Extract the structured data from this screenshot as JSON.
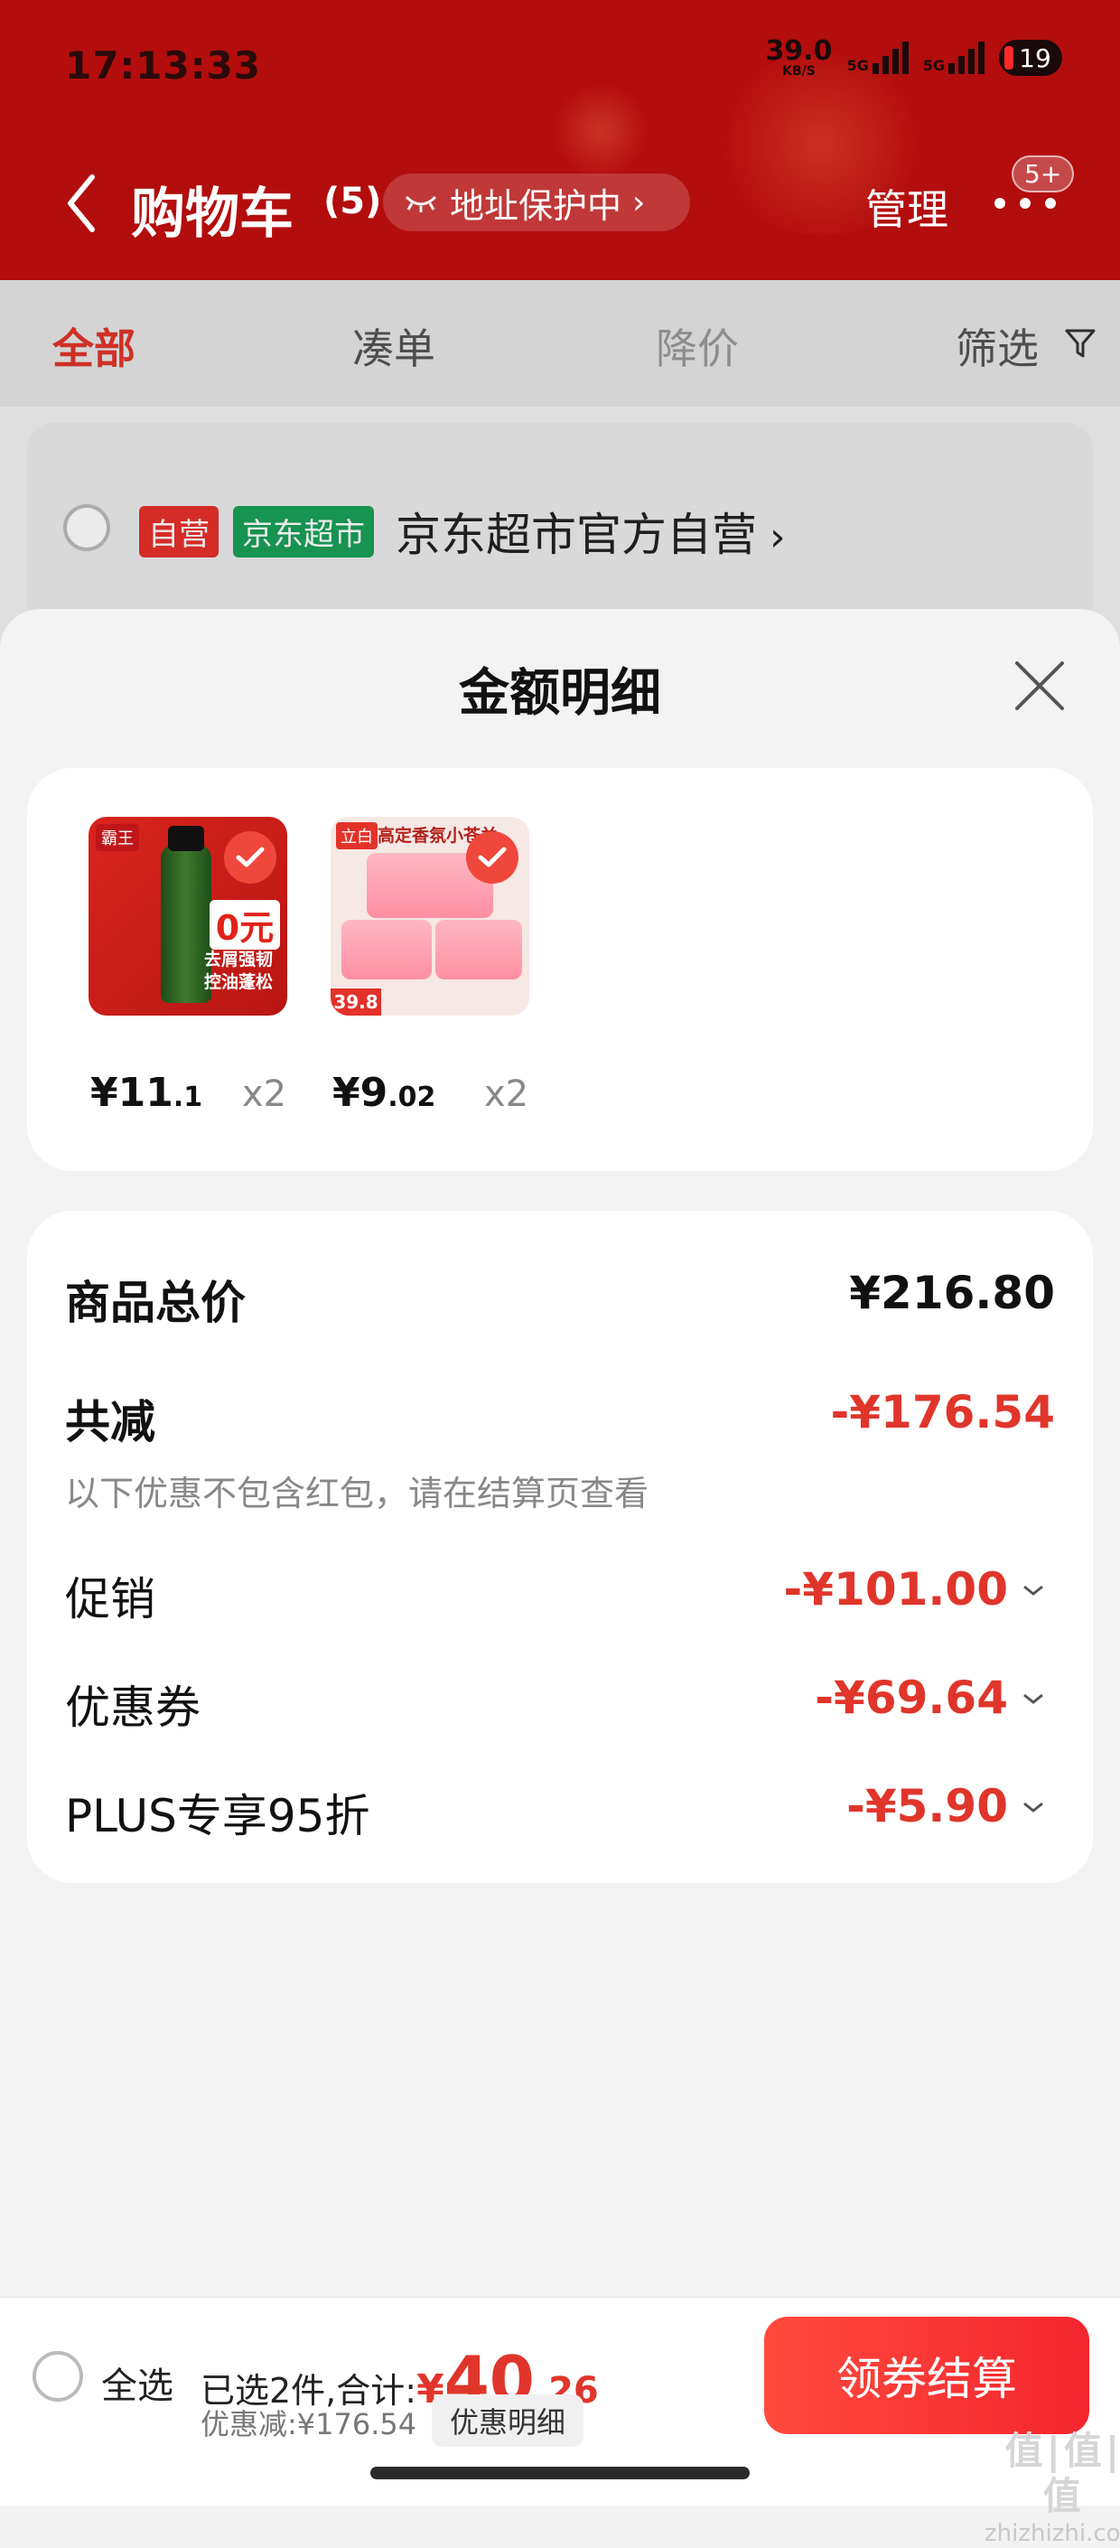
{
  "status_bar": {
    "time": "17:13:33",
    "net_speed_value": "39.0",
    "net_speed_unit": "KB/S",
    "signal1_label": "5G",
    "signal2_label": "5G",
    "battery": "19"
  },
  "header": {
    "title": "购物车",
    "count": "(5)",
    "address_protection": "地址保护中",
    "manage": "管理",
    "more_badge": "5+"
  },
  "tabs": [
    {
      "label": "全部",
      "active": true
    },
    {
      "label": "凑单",
      "active": false
    },
    {
      "label": "降价",
      "active": false
    },
    {
      "label": "筛选",
      "active": false
    }
  ],
  "store": {
    "tag_self": "自营",
    "tag_market": "京东超市",
    "name": "京东超市官方自营"
  },
  "sheet": {
    "title": "金额明细",
    "products": [
      {
        "price_int": "¥11",
        "price_dec": ".1",
        "qty": "x2",
        "thumb_texts": [
          "霸王",
          "0元",
          "去屑强韧",
          "控油蓬松"
        ]
      },
      {
        "price_int": "¥9",
        "price_dec": ".02",
        "qty": "x2",
        "thumb_texts": [
          "立白",
          "高定香氛小苍兰",
          "39.8"
        ]
      }
    ],
    "summary": {
      "total_label": "商品总价",
      "total_value": "¥216.80",
      "reduce_label": "共减",
      "reduce_value": "-¥176.54",
      "note": "以下优惠不包含红包，请在结算页查看",
      "items": [
        {
          "label": "促销",
          "value": "-¥101.00"
        },
        {
          "label": "优惠券",
          "value": "-¥69.64"
        },
        {
          "label": "PLUS专享95折",
          "value": "-¥5.90"
        }
      ]
    }
  },
  "bottom": {
    "select_all": "全选",
    "selected_text": "已选2件,合计:",
    "total_symbol": "¥",
    "total_int": "40",
    "total_dec": ".26",
    "discount_text": "优惠减:¥176.54",
    "detail_button": "优惠明细",
    "checkout": "领券结算"
  },
  "watermark": {
    "main": "值|值|值",
    "sub": "zhizhizhi.com"
  },
  "colors": {
    "header_red": "#b30d0d",
    "accent_red": "#e0352b",
    "checkout_red": "#f4252e"
  }
}
